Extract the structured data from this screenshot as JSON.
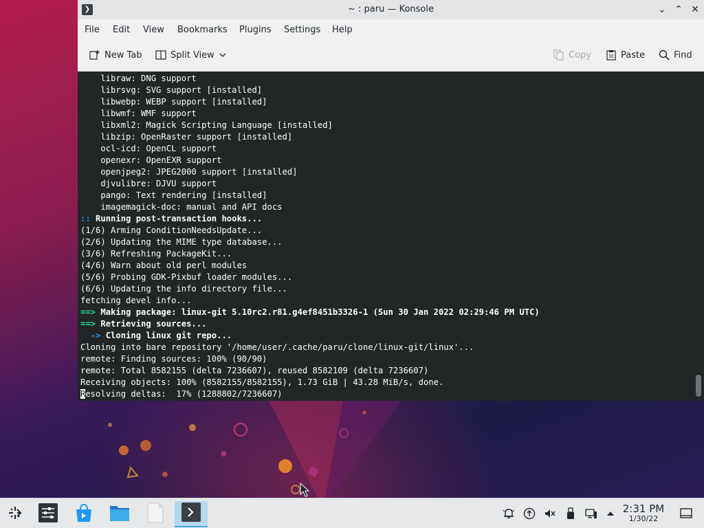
{
  "window": {
    "title": "~ : paru — Konsole",
    "app_icon": "terminal-icon"
  },
  "menu": [
    "File",
    "Edit",
    "View",
    "Bookmarks",
    "Plugins",
    "Settings",
    "Help"
  ],
  "toolbar": {
    "new_tab": "New Tab",
    "split_view": "Split View",
    "copy": "Copy",
    "paste": "Paste",
    "find": "Find"
  },
  "terminal": {
    "lines": [
      {
        "segments": [
          {
            "t": "    libraw: DNG support",
            "c": ""
          }
        ]
      },
      {
        "segments": [
          {
            "t": "    librsvg: SVG support [installed]",
            "c": ""
          }
        ]
      },
      {
        "segments": [
          {
            "t": "    libwebp: WEBP support [installed]",
            "c": ""
          }
        ]
      },
      {
        "segments": [
          {
            "t": "    libwmf: WMF support",
            "c": ""
          }
        ]
      },
      {
        "segments": [
          {
            "t": "    libxml2: Magick Scripting Language [installed]",
            "c": ""
          }
        ]
      },
      {
        "segments": [
          {
            "t": "    libzip: OpenRaster support [installed]",
            "c": ""
          }
        ]
      },
      {
        "segments": [
          {
            "t": "    ocl-icd: OpenCL support",
            "c": ""
          }
        ]
      },
      {
        "segments": [
          {
            "t": "    openexr: OpenEXR support",
            "c": ""
          }
        ]
      },
      {
        "segments": [
          {
            "t": "    openjpeg2: JPEG2000 support [installed]",
            "c": ""
          }
        ]
      },
      {
        "segments": [
          {
            "t": "    djvulibre: DJVU support",
            "c": ""
          }
        ]
      },
      {
        "segments": [
          {
            "t": "    pango: Text rendering [installed]",
            "c": ""
          }
        ]
      },
      {
        "segments": [
          {
            "t": "    imagemagick-doc: manual and API docs",
            "c": ""
          }
        ]
      },
      {
        "segments": [
          {
            "t": ":: ",
            "c": "t-blue"
          },
          {
            "t": "Running post-transaction hooks...",
            "c": "t-bold"
          }
        ]
      },
      {
        "segments": [
          {
            "t": "(1/6) Arming ConditionNeedsUpdate...",
            "c": ""
          }
        ]
      },
      {
        "segments": [
          {
            "t": "(2/6) Updating the MIME type database...",
            "c": ""
          }
        ]
      },
      {
        "segments": [
          {
            "t": "(3/6) Refreshing PackageKit...",
            "c": ""
          }
        ]
      },
      {
        "segments": [
          {
            "t": "(4/6) Warn about old perl modules",
            "c": ""
          }
        ]
      },
      {
        "segments": [
          {
            "t": "(5/6) Probing GDK-Pixbuf loader modules...",
            "c": ""
          }
        ]
      },
      {
        "segments": [
          {
            "t": "(6/6) Updating the info directory file...",
            "c": ""
          }
        ]
      },
      {
        "segments": [
          {
            "t": "fetching devel info...",
            "c": ""
          }
        ]
      },
      {
        "segments": [
          {
            "t": "==> ",
            "c": "t-green"
          },
          {
            "t": "Making package: linux-git 5.10rc2.r81.g4ef8451b3326-1 (Sun 30 Jan 2022 02:29:46 PM UTC)",
            "c": "t-bold"
          }
        ]
      },
      {
        "segments": [
          {
            "t": "==> ",
            "c": "t-green"
          },
          {
            "t": "Retrieving sources...",
            "c": "t-bold"
          }
        ]
      },
      {
        "segments": [
          {
            "t": "  -> ",
            "c": "t-blue"
          },
          {
            "t": "Cloning linux git repo...",
            "c": "t-bold"
          }
        ]
      },
      {
        "segments": [
          {
            "t": "Cloning into bare repository '/home/user/.cache/paru/clone/linux-git/linux'...",
            "c": ""
          }
        ]
      },
      {
        "segments": [
          {
            "t": "remote: Finding sources: 100% (90/90)",
            "c": ""
          }
        ]
      },
      {
        "segments": [
          {
            "t": "remote: Total 8582155 (delta 7236607), reused 8582109 (delta 7236607)",
            "c": ""
          }
        ]
      },
      {
        "segments": [
          {
            "t": "Receiving objects: 100% (8582155/8582155), 1.73 GiB | 43.28 MiB/s, done.",
            "c": ""
          }
        ]
      },
      {
        "segments": [
          {
            "t": "R",
            "c": "cursor"
          },
          {
            "t": "esolving deltas:  17% (1288802/7236607)",
            "c": ""
          }
        ]
      }
    ]
  },
  "taskbar": {
    "apps": [
      "app-launcher-icon",
      "system-settings-icon",
      "discover-icon",
      "dolphin-icon",
      "kate-icon",
      "konsole-icon"
    ],
    "tray": [
      "notifications-icon",
      "updates-icon",
      "volume-muted-icon",
      "usb-icon",
      "network-icon",
      "expand-tray-icon"
    ],
    "time": "2:31 PM",
    "date": "1/30/22"
  },
  "colors": {
    "terminal_bg": "#232627",
    "accent": "#3daee9",
    "prompt_blue": "#1d99f3",
    "prompt_green": "#1cdc9a"
  }
}
